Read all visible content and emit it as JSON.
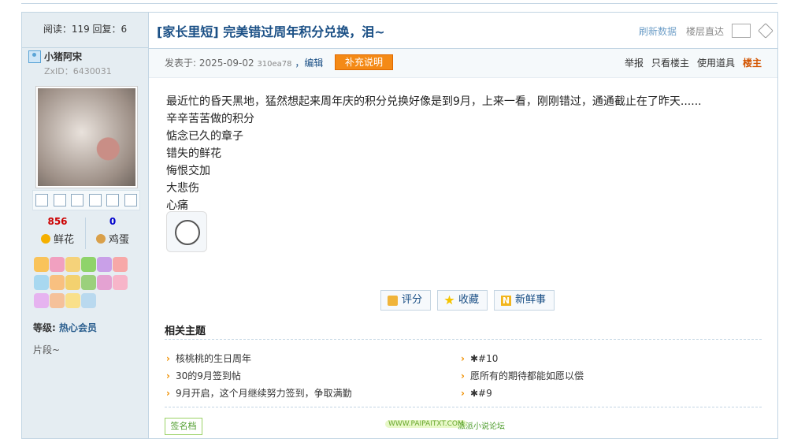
{
  "sidebar": {
    "stats_line": "阅读：119 回复：6",
    "username": "小猪阿宋",
    "zxid": "ZxID：6430031",
    "flowers_count": "856",
    "flowers_label": "鲜花",
    "eggs_count": "0",
    "eggs_label": "鸡蛋",
    "level_label": "等级:",
    "level_value": "热心会员",
    "pianduan": "片段~"
  },
  "post": {
    "title": "[家长里短] 完美错过周年积分兑换，泪~",
    "refresh": "刷新数据",
    "floor_jump": "楼层直达",
    "posted_at": "发表于: 2025-09-02",
    "hash": "310ea78",
    "edit": "，编辑",
    "supplement": "补充说明",
    "report": "举报",
    "only_op": "只看楼主",
    "use_tool": "使用道具",
    "op_tag": "楼主",
    "lines": [
      "最近忙的昏天黑地，猛然想起来周年庆的积分兑换好像是到9月，上来一看，刚刚错过，通通截止在了昨天......",
      "辛辛苦苦做的积分",
      "惦念已久的章子",
      "错失的鲜花",
      "悔恨交加",
      "大悲伤",
      "心痛"
    ]
  },
  "actions": {
    "rate": "评分",
    "fav": "收藏",
    "fresh": "新鲜事"
  },
  "related": {
    "title": "相关主题",
    "left": [
      "核桃桃的生日周年",
      "30的9月签到帖",
      "9月开启，这个月继续努力签到，争取满勤"
    ],
    "right": [
      "✱#10",
      "愿所有的期待都能如愿以偿",
      "✱#9"
    ]
  },
  "footer": {
    "sig": "签名档",
    "site": "WWW.PAIPAITXT.COM",
    "sitename": "派派小说论坛"
  },
  "colors": {
    "accent": "#1a4f85",
    "orange": "#f48a16",
    "border": "#c2d5e3",
    "sidebar_bg": "#e5edf2"
  }
}
